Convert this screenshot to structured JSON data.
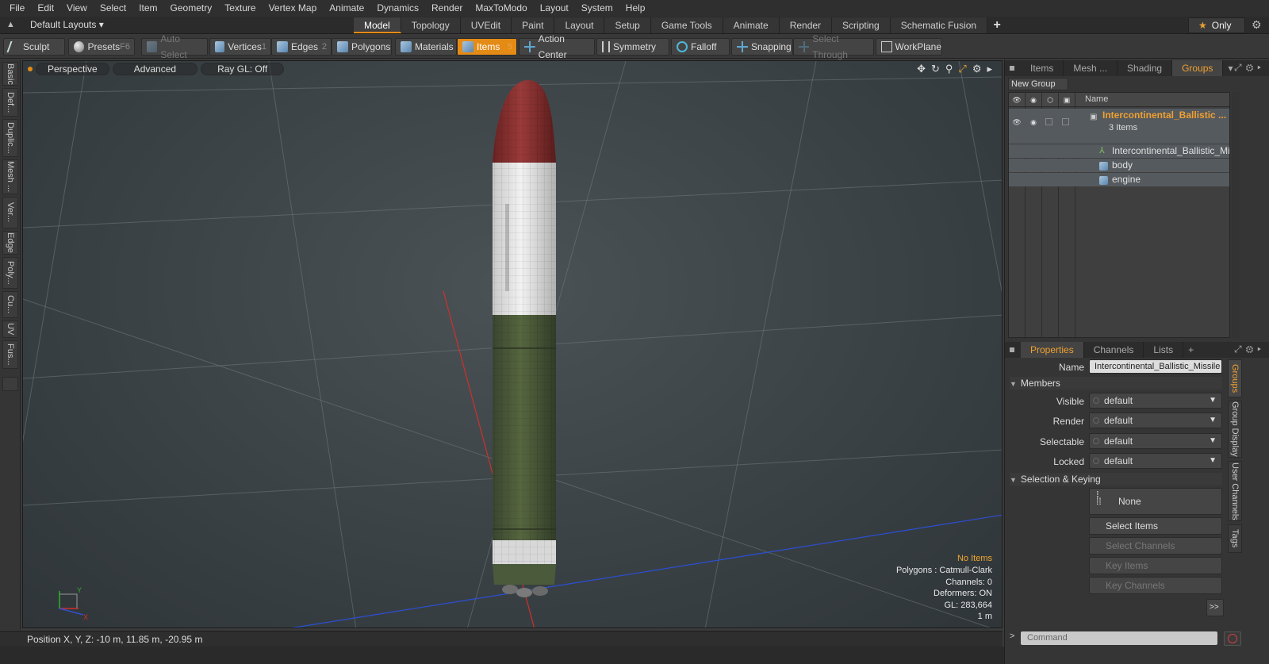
{
  "menu": [
    "File",
    "Edit",
    "View",
    "Select",
    "Item",
    "Geometry",
    "Texture",
    "Vertex Map",
    "Animate",
    "Dynamics",
    "Render",
    "MaxToModo",
    "Layout",
    "System",
    "Help"
  ],
  "layout": {
    "dropdown": "Default Layouts ▾"
  },
  "mode_tabs": [
    "Model",
    "Topology",
    "UVEdit",
    "Paint",
    "Layout",
    "Setup",
    "Game Tools",
    "Animate",
    "Render",
    "Scripting",
    "Schematic Fusion"
  ],
  "active_mode_tab": "Model",
  "only_label": "Only",
  "toolbar": {
    "sculpt": "Sculpt",
    "presets": "Presets",
    "presets_key": "F6",
    "auto_select": "Auto Select",
    "vertices": "Vertices",
    "vertices_key": "1",
    "edges": "Edges",
    "edges_key": "2",
    "polygons": "Polygons",
    "materials": "Materials",
    "items": "Items",
    "items_key": "5",
    "action_center": "Action Center",
    "symmetry": "Symmetry",
    "falloff": "Falloff",
    "snapping": "Snapping",
    "select_through": "Select Through",
    "workplane": "WorkPlane"
  },
  "left_tabs": [
    "Basic",
    "Def...",
    "Duplic...",
    "Mesh ...",
    "Ver...",
    "Edge",
    "Poly...",
    "Cu...",
    "UV",
    "Fus..."
  ],
  "viewport": {
    "perspective": "Perspective",
    "advanced": "Advanced",
    "raygl": "Ray GL: Off",
    "info": {
      "no_items": "No Items",
      "polygons": "Polygons : Catmull-Clark",
      "channels": "Channels: 0",
      "deformers": "Deformers: ON",
      "gl": "GL: 283,664",
      "scale": "1 m"
    }
  },
  "status": {
    "position": "Position X, Y, Z:  -10 m, 11.85 m, -20.95 m"
  },
  "panel_tabs": [
    "Items",
    "Mesh ...",
    "Shading",
    "Groups"
  ],
  "active_panel_tab": "Groups",
  "new_group": "New Group",
  "item_list": {
    "name_header": "Name",
    "group_name": "Intercontinental_Ballistic ...",
    "group_count": "3 Items",
    "children": [
      "Intercontinental_Ballistic_Mi ...",
      "body",
      "engine"
    ]
  },
  "props_tabs": [
    "Properties",
    "Channels",
    "Lists"
  ],
  "active_props_tab": "Properties",
  "properties": {
    "name_label": "Name",
    "name_value": "Intercontinental_Ballistic_Missile (",
    "members": "Members",
    "visible_label": "Visible",
    "render_label": "Render",
    "selectable_label": "Selectable",
    "locked_label": "Locked",
    "dd_value": "default",
    "selection_keying": "Selection & Keying",
    "none": "None",
    "select_items": "Select Items",
    "select_channels": "Select Channels",
    "key_items": "Key Items",
    "key_channels": "Key Channels",
    "more": ">>"
  },
  "right_vtabs": [
    "Groups",
    "Group Display",
    "User Channels",
    "Tags"
  ],
  "command_placeholder": "Command",
  "colors": {
    "accent": "#e48b16",
    "selected_text": "#f0a030",
    "nose": "#8a2f2f",
    "body_green": "#4b5a3c",
    "body_white": "#e6e6e6"
  }
}
